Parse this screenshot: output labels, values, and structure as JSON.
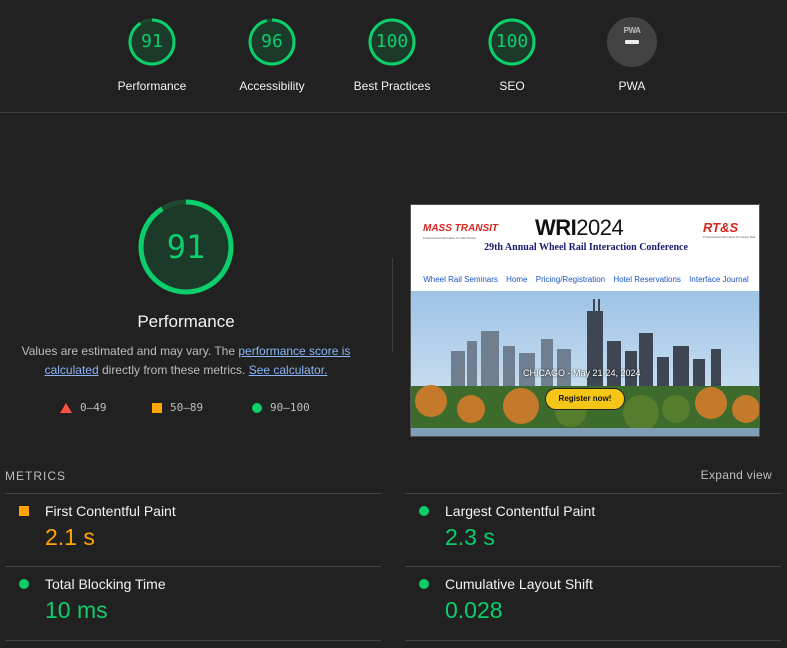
{
  "categories": [
    {
      "score": "91",
      "label": "Performance",
      "fraction": 0.91
    },
    {
      "score": "96",
      "label": "Accessibility",
      "fraction": 0.96
    },
    {
      "score": "100",
      "label": "Best Practices",
      "fraction": 1.0
    },
    {
      "score": "100",
      "label": "SEO",
      "fraction": 1.0
    },
    {
      "score": "",
      "label": "PWA",
      "badge": "PWA"
    }
  ],
  "performance": {
    "score": "91",
    "fraction": 0.91,
    "title": "Performance",
    "desc_pre": "Values are estimated and may vary. The ",
    "desc_link1": "performance score is calculated",
    "desc_mid": " directly from these metrics. ",
    "desc_link2": "See calculator."
  },
  "legend": [
    {
      "shape": "triangle",
      "range": "0–49",
      "color": "#ff4e42"
    },
    {
      "shape": "square",
      "range": "50–89",
      "color": "#ffa400"
    },
    {
      "shape": "circle",
      "range": "90–100",
      "color": "#0cce6b"
    }
  ],
  "screenshot": {
    "left_logo": "MASS TRANSIT",
    "left_logo_sub": "Professional Information for Rail Transit",
    "title_wri": "WRI",
    "title_year": "2024",
    "conference": "29th Annual Wheel Rail Interaction Conference",
    "right_logo": "RT&S",
    "right_logo_sub": "Professional Information for Heavy Rail",
    "nav": [
      "Wheel Rail Seminars",
      "Home",
      "Pricing/Registration",
      "Hotel Reservations",
      "Interface Journal"
    ],
    "caption": "CHICAGO - May 21-24, 2024",
    "register": "Register now!"
  },
  "metrics_header": "METRICS",
  "expand_label": "Expand view",
  "metrics": [
    {
      "name": "First Contentful Paint",
      "value": "2.1 s",
      "rating": "average"
    },
    {
      "name": "Largest Contentful Paint",
      "value": "2.3 s",
      "rating": "pass"
    },
    {
      "name": "Total Blocking Time",
      "value": "10 ms",
      "rating": "pass"
    },
    {
      "name": "Cumulative Layout Shift",
      "value": "0.028",
      "rating": "pass"
    }
  ],
  "colors": {
    "pass": "#0cce6b",
    "average": "#ffa400",
    "fail": "#ff4e42",
    "link": "#8ab4f8"
  }
}
